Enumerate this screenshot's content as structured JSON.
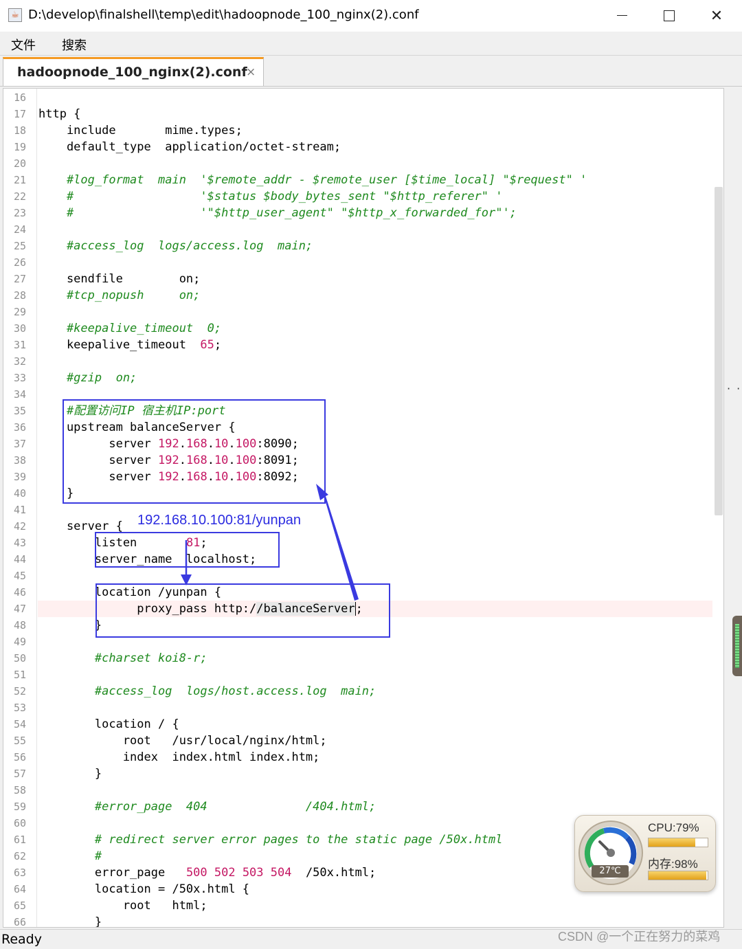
{
  "window": {
    "title": "D:\\develop\\finalshell\\temp\\edit\\hadoopnode_100_nginx(2).conf",
    "app_icon": "java-cup-icon",
    "controls": [
      "minimize-icon",
      "maximize-icon",
      "close-icon"
    ]
  },
  "menu": {
    "file": "文件",
    "search": "搜索"
  },
  "tab": {
    "label": "hadoopnode_100_nginx(2).conf",
    "close": "×"
  },
  "editor": {
    "lines": [
      {
        "n": "16",
        "segs": []
      },
      {
        "n": "17",
        "segs": [
          {
            "t": "http {",
            "c": ""
          }
        ]
      },
      {
        "n": "18",
        "segs": [
          {
            "t": "    include       mime.types;",
            "c": ""
          }
        ]
      },
      {
        "n": "19",
        "segs": [
          {
            "t": "    default_type  application/octet-stream;",
            "c": ""
          }
        ]
      },
      {
        "n": "20",
        "segs": []
      },
      {
        "n": "21",
        "segs": [
          {
            "t": "    #log_format  main  '$remote_addr - $remote_user [$time_local] \"$request\" '",
            "c": "cm"
          }
        ]
      },
      {
        "n": "22",
        "segs": [
          {
            "t": "    #                  '$status $body_bytes_sent \"$http_referer\" '",
            "c": "cm"
          }
        ]
      },
      {
        "n": "23",
        "segs": [
          {
            "t": "    #                  '\"$http_user_agent\" \"$http_x_forwarded_for\"';",
            "c": "cm"
          }
        ]
      },
      {
        "n": "24",
        "segs": []
      },
      {
        "n": "25",
        "segs": [
          {
            "t": "    #access_log  logs/access.log  main;",
            "c": "cm"
          }
        ]
      },
      {
        "n": "26",
        "segs": []
      },
      {
        "n": "27",
        "segs": [
          {
            "t": "    sendfile        on;",
            "c": ""
          }
        ]
      },
      {
        "n": "28",
        "segs": [
          {
            "t": "    #tcp_nopush     on;",
            "c": "cm"
          }
        ]
      },
      {
        "n": "29",
        "segs": []
      },
      {
        "n": "30",
        "segs": [
          {
            "t": "    #keepalive_timeout  0;",
            "c": "cm"
          }
        ]
      },
      {
        "n": "31",
        "segs": [
          {
            "t": "    keepalive_timeout  ",
            "c": ""
          },
          {
            "t": "65",
            "c": "nm"
          },
          {
            "t": ";",
            "c": ""
          }
        ]
      },
      {
        "n": "32",
        "segs": []
      },
      {
        "n": "33",
        "segs": [
          {
            "t": "    #gzip  on;",
            "c": "cm"
          }
        ]
      },
      {
        "n": "34",
        "segs": []
      },
      {
        "n": "35",
        "segs": [
          {
            "t": "    #配置访问IP 宿主机IP:port",
            "c": "cm"
          }
        ]
      },
      {
        "n": "36",
        "segs": [
          {
            "t": "    upstream balanceServer {",
            "c": ""
          }
        ]
      },
      {
        "n": "37",
        "segs": [
          {
            "t": "          server ",
            "c": ""
          },
          {
            "t": "192",
            "c": "nm"
          },
          {
            "t": ".",
            "c": ""
          },
          {
            "t": "168",
            "c": "nm"
          },
          {
            "t": ".",
            "c": ""
          },
          {
            "t": "10",
            "c": "nm"
          },
          {
            "t": ".",
            "c": ""
          },
          {
            "t": "100",
            "c": "nm"
          },
          {
            "t": ":8090;",
            "c": ""
          }
        ]
      },
      {
        "n": "38",
        "segs": [
          {
            "t": "          server ",
            "c": ""
          },
          {
            "t": "192",
            "c": "nm"
          },
          {
            "t": ".",
            "c": ""
          },
          {
            "t": "168",
            "c": "nm"
          },
          {
            "t": ".",
            "c": ""
          },
          {
            "t": "10",
            "c": "nm"
          },
          {
            "t": ".",
            "c": ""
          },
          {
            "t": "100",
            "c": "nm"
          },
          {
            "t": ":8091;",
            "c": ""
          }
        ]
      },
      {
        "n": "39",
        "segs": [
          {
            "t": "          server ",
            "c": ""
          },
          {
            "t": "192",
            "c": "nm"
          },
          {
            "t": ".",
            "c": ""
          },
          {
            "t": "168",
            "c": "nm"
          },
          {
            "t": ".",
            "c": ""
          },
          {
            "t": "10",
            "c": "nm"
          },
          {
            "t": ".",
            "c": ""
          },
          {
            "t": "100",
            "c": "nm"
          },
          {
            "t": ":8092;",
            "c": ""
          }
        ]
      },
      {
        "n": "40",
        "segs": [
          {
            "t": "    }",
            "c": ""
          }
        ]
      },
      {
        "n": "41",
        "segs": []
      },
      {
        "n": "42",
        "segs": [
          {
            "t": "    server {",
            "c": ""
          }
        ]
      },
      {
        "n": "43",
        "segs": [
          {
            "t": "        listen       ",
            "c": ""
          },
          {
            "t": "81",
            "c": "nm"
          },
          {
            "t": ";",
            "c": ""
          }
        ]
      },
      {
        "n": "44",
        "segs": [
          {
            "t": "        server_name  localhost;",
            "c": ""
          }
        ]
      },
      {
        "n": "45",
        "segs": []
      },
      {
        "n": "46",
        "segs": [
          {
            "t": "        location /yunpan {",
            "c": ""
          }
        ]
      },
      {
        "n": "47",
        "segs": [
          {
            "t": "              proxy_pass http:/",
            "c": ""
          },
          {
            "t": "/balanceServer",
            "c": "sel"
          },
          {
            "t": ";",
            "c": ""
          }
        ],
        "highlight": true
      },
      {
        "n": "48",
        "segs": [
          {
            "t": "        }",
            "c": ""
          }
        ]
      },
      {
        "n": "49",
        "segs": []
      },
      {
        "n": "50",
        "segs": [
          {
            "t": "        #charset koi8-r;",
            "c": "cm"
          }
        ]
      },
      {
        "n": "51",
        "segs": []
      },
      {
        "n": "52",
        "segs": [
          {
            "t": "        #access_log  logs/host.access.log  main;",
            "c": "cm"
          }
        ]
      },
      {
        "n": "53",
        "segs": []
      },
      {
        "n": "54",
        "segs": [
          {
            "t": "        location / {",
            "c": ""
          }
        ]
      },
      {
        "n": "55",
        "segs": [
          {
            "t": "            root   /usr/local/nginx/html;",
            "c": ""
          }
        ]
      },
      {
        "n": "56",
        "segs": [
          {
            "t": "            index  index.html index.htm;",
            "c": ""
          }
        ]
      },
      {
        "n": "57",
        "segs": [
          {
            "t": "        }",
            "c": ""
          }
        ]
      },
      {
        "n": "58",
        "segs": []
      },
      {
        "n": "59",
        "segs": [
          {
            "t": "        #error_page  404              /404.html;",
            "c": "cm"
          }
        ]
      },
      {
        "n": "60",
        "segs": []
      },
      {
        "n": "61",
        "segs": [
          {
            "t": "        # redirect server error pages to the static page /50x.html",
            "c": "cm"
          }
        ]
      },
      {
        "n": "62",
        "segs": [
          {
            "t": "        #",
            "c": "cm"
          }
        ]
      },
      {
        "n": "63",
        "segs": [
          {
            "t": "        error_page   ",
            "c": ""
          },
          {
            "t": "500 502 503 504",
            "c": "nm"
          },
          {
            "t": "  /50x.html;",
            "c": ""
          }
        ]
      },
      {
        "n": "64",
        "segs": [
          {
            "t": "        location = /50x.html {",
            "c": ""
          }
        ]
      },
      {
        "n": "65",
        "segs": [
          {
            "t": "            root   html;",
            "c": ""
          }
        ]
      },
      {
        "n": "66",
        "segs": [
          {
            "t": "        }",
            "c": ""
          }
        ]
      }
    ]
  },
  "annotation": {
    "text": "192.168.10.100:81/yunpan",
    "color": "#3a3ae0"
  },
  "status": {
    "text": "Ready"
  },
  "watermark": {
    "text": "CSDN @一个正在努力的菜鸡"
  },
  "monitor": {
    "cpu_label": "CPU:79%",
    "cpu_fraction": 0.79,
    "mem_label": "内存:98%",
    "mem_fraction": 0.98,
    "temp": "27℃"
  },
  "colors": {
    "comment": "#1e8a1e",
    "number": "#c41763",
    "tab_accent": "#f59a23"
  }
}
